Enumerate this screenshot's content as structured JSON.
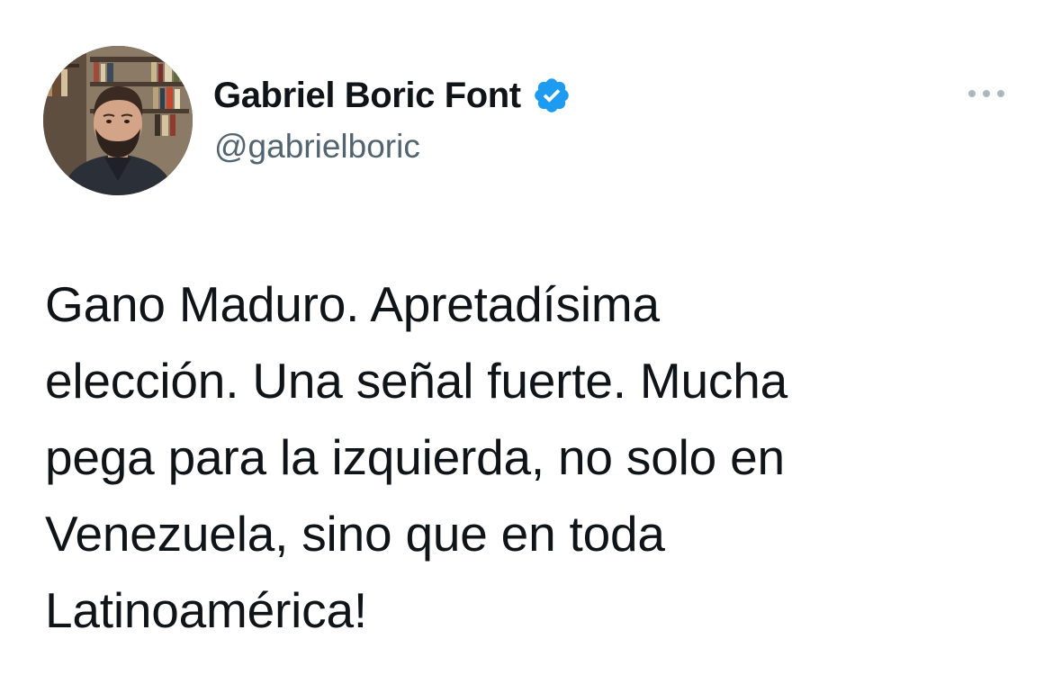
{
  "author": {
    "display_name": "Gabriel Boric Font",
    "handle": "@gabrielboric",
    "verified_icon": "verified-badge-icon",
    "avatar_icon": "profile-photo"
  },
  "menu": {
    "more_icon": "more-horizontal-icon"
  },
  "tweet": {
    "lines": [
      "Gano Maduro. Apretadísima",
      "elección. Una señal fuerte. Mucha",
      "pega para la izquierda, no solo en",
      "Venezuela, sino que en toda",
      "Latinoamérica!"
    ]
  },
  "colors": {
    "text": "#0f1419",
    "secondary": "#536471",
    "verified_blue": "#1d9bf0",
    "background": "#ffffff"
  }
}
